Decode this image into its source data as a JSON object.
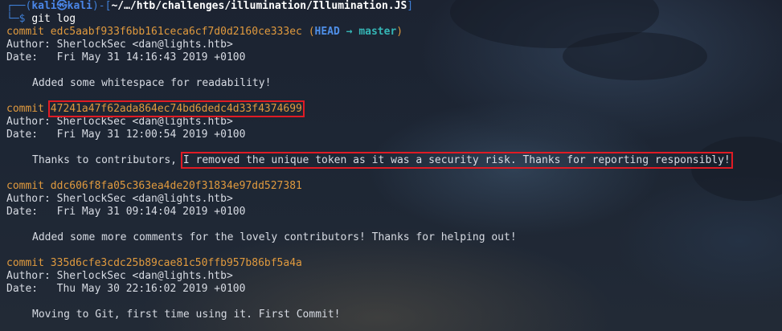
{
  "prompt": {
    "corner_top": "┌──(",
    "user": "kali",
    "skull": "㉿",
    "host": "kali",
    "mid": ")-[",
    "path": "~/…/htb/challenges/illumination/Illumination.JS",
    "end": "]",
    "corner_bottom": "└─",
    "symbol": "$",
    "command": "git log"
  },
  "labels": {
    "commit": "commit",
    "author": "Author:",
    "date": "Date:"
  },
  "head_ref": {
    "open": "(",
    "head": "HEAD",
    "arrow": "→",
    "branch": "master",
    "close": ")"
  },
  "commits": [
    {
      "hash": "edc5aabf933f6bb161ceca6cf7d0d2160ce333ec",
      "author": "SherlockSec <dan@lights.htb>",
      "date": "Fri May 31 14:16:43 2019 +0100",
      "message": "Added some whitespace for readability!"
    },
    {
      "hash": "47241a47f62ada864ec74bd6dedc4d33f4374699",
      "author": "SherlockSec <dan@lights.htb>",
      "date": "Fri May 31 12:00:54 2019 +0100",
      "message_prefix": "Thanks to contributors, ",
      "message_highlight": "I removed the unique token as it was a security risk. Thanks for reporting responsibly!"
    },
    {
      "hash": "ddc606f8fa05c363ea4de20f31834e97dd527381",
      "author": "SherlockSec <dan@lights.htb>",
      "date": "Fri May 31 09:14:04 2019 +0100",
      "message": "Added some more comments for the lovely contributors! Thanks for helping out!"
    },
    {
      "hash": "335d6cfe3cdc25b89cae81c50ffb957b86bf5a4a",
      "author": "SherlockSec <dan@lights.htb>",
      "date": "Thu May 30 22:16:02 2019 +0100",
      "message": "Moving to Git, first time using it. First Commit!"
    }
  ],
  "colors": {
    "background": "#1b2230",
    "commit_line": "#e09a3e",
    "prompt_blue": "#3f7fd6",
    "branch_cyan": "#35b6b6",
    "highlight_box": "#e01b24"
  }
}
